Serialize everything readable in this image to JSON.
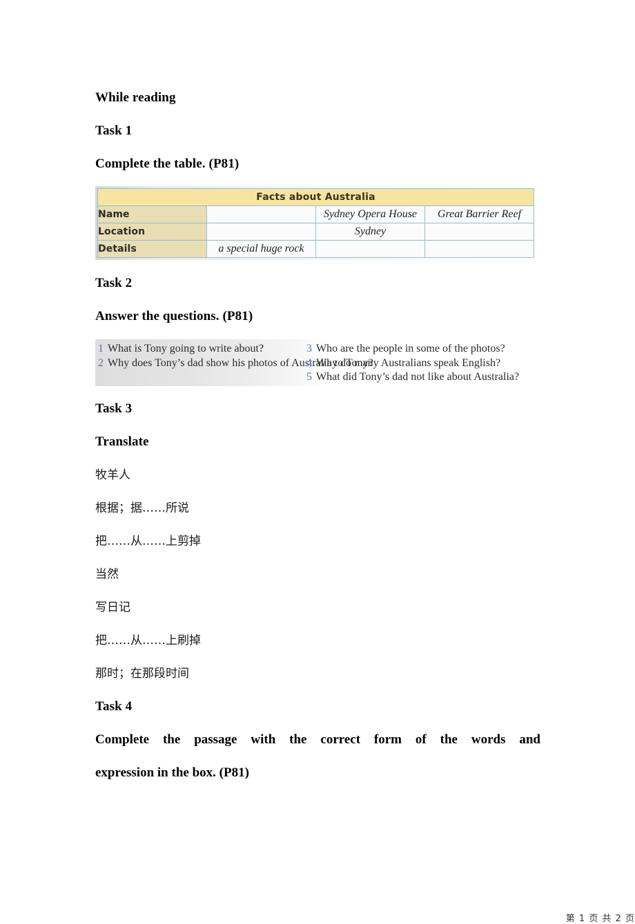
{
  "document": {
    "section_title": "While reading",
    "tasks": [
      {
        "label": "Task 1",
        "instruction": "Complete the table. (P81)"
      },
      {
        "label": "Task 2",
        "instruction": "Answer the questions. (P81)"
      },
      {
        "label": "Task 3",
        "instruction": "Translate"
      },
      {
        "label": "Task 4",
        "instruction_line1": "Complete  the  passage  with  the  correct  form  of  the  words  and",
        "instruction_line2": "expression in the box. (P81)"
      }
    ],
    "table": {
      "title": "Facts about Australia",
      "row_headers": [
        "Name",
        "Location",
        "Details"
      ],
      "rows": [
        {
          "header": "Name",
          "cells": [
            "",
            "Sydney Opera House",
            "Great Barrier Reef"
          ]
        },
        {
          "header": "Location",
          "cells": [
            "",
            "Sydney",
            ""
          ]
        },
        {
          "header": "Details",
          "cells": [
            "a special huge rock",
            "",
            ""
          ]
        }
      ],
      "colors": {
        "title_bg": "#f7e4a0",
        "header_bg": "#e9ddb4",
        "cell_bg": "#fbfbfc",
        "border": "#93bcd9"
      }
    },
    "questions": {
      "left_column": [
        {
          "num": "1",
          "text": "What is Tony going to write about?"
        },
        {
          "num": "2",
          "text": "Why does Tony’s dad show his photos of Australia to Tony?"
        }
      ],
      "right_column": [
        {
          "num": "3",
          "text": "Who are the people in some of the photos?"
        },
        {
          "num": "4",
          "text": "Why do many Australians speak English?"
        },
        {
          "num": "5",
          "text": "What did Tony’s dad not like about Australia?"
        }
      ],
      "num_color": "#4a78b5"
    },
    "translate_items": [
      "牧羊人",
      "根据；据……所说",
      "把……从……上剪掉",
      "当然",
      "写日记",
      "把……从……上刷掉",
      "那时；在那段时间"
    ],
    "footer": "第 1 页 共 2 页"
  }
}
